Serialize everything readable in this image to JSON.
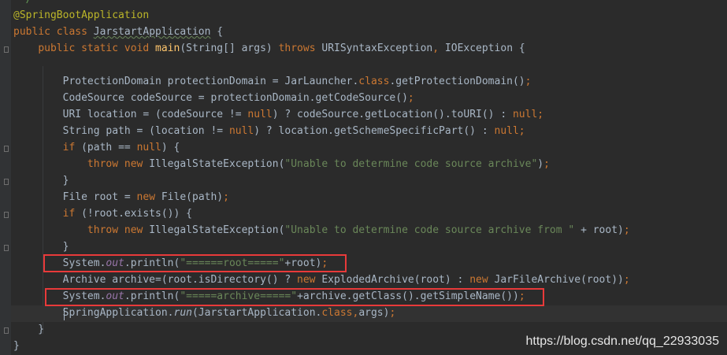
{
  "editor": {
    "comment_end": " */",
    "lines": [
      {
        "parts": [
          {
            "c": "ann",
            "t": "@SpringBootApplication"
          }
        ]
      },
      {
        "parts": [
          {
            "c": "kw",
            "t": "public class "
          },
          {
            "c": "squig",
            "t": "JarstartApplication"
          },
          {
            "c": "",
            "t": " {"
          }
        ]
      },
      {
        "parts": [
          {
            "c": "",
            "t": "    "
          },
          {
            "c": "kw",
            "t": "public static void "
          },
          {
            "c": "fn",
            "t": "main"
          },
          {
            "c": "",
            "t": "(String[] args) "
          },
          {
            "c": "kw",
            "t": "throws "
          },
          {
            "c": "",
            "t": "URISyntaxException"
          },
          {
            "c": "kw",
            "t": ", "
          },
          {
            "c": "",
            "t": "IOException {"
          }
        ]
      },
      {
        "parts": [
          {
            "c": "",
            "t": ""
          }
        ]
      },
      {
        "parts": [
          {
            "c": "",
            "t": "        ProtectionDomain protectionDomain = JarLauncher."
          },
          {
            "c": "kw",
            "t": "class"
          },
          {
            "c": "",
            "t": ".getProtectionDomain()"
          },
          {
            "c": "kw",
            "t": ";"
          }
        ]
      },
      {
        "parts": [
          {
            "c": "",
            "t": "        CodeSource codeSource = protectionDomain.getCodeSource()"
          },
          {
            "c": "kw",
            "t": ";"
          }
        ]
      },
      {
        "parts": [
          {
            "c": "",
            "t": "        URI location = (codeSource != "
          },
          {
            "c": "kw",
            "t": "null"
          },
          {
            "c": "",
            "t": ") ? codeSource.getLocation().toURI() : "
          },
          {
            "c": "kw",
            "t": "null;"
          }
        ]
      },
      {
        "parts": [
          {
            "c": "",
            "t": "        String path = (location != "
          },
          {
            "c": "kw",
            "t": "null"
          },
          {
            "c": "",
            "t": ") ? location.getSchemeSpecificPart() : "
          },
          {
            "c": "kw",
            "t": "null;"
          }
        ]
      },
      {
        "parts": [
          {
            "c": "",
            "t": "        "
          },
          {
            "c": "kw",
            "t": "if "
          },
          {
            "c": "",
            "t": "(path == "
          },
          {
            "c": "kw",
            "t": "null"
          },
          {
            "c": "",
            "t": ") {"
          }
        ]
      },
      {
        "parts": [
          {
            "c": "",
            "t": "            "
          },
          {
            "c": "kw",
            "t": "throw new "
          },
          {
            "c": "",
            "t": "IllegalStateException("
          },
          {
            "c": "str",
            "t": "\"Unable to determine code source archive\""
          },
          {
            "c": "",
            "t": ")"
          },
          {
            "c": "kw",
            "t": ";"
          }
        ]
      },
      {
        "parts": [
          {
            "c": "",
            "t": "        }"
          }
        ]
      },
      {
        "parts": [
          {
            "c": "",
            "t": "        File root = "
          },
          {
            "c": "kw",
            "t": "new "
          },
          {
            "c": "",
            "t": "File(path)"
          },
          {
            "c": "kw",
            "t": ";"
          }
        ]
      },
      {
        "parts": [
          {
            "c": "",
            "t": "        "
          },
          {
            "c": "kw",
            "t": "if "
          },
          {
            "c": "",
            "t": "(!root.exists()) {"
          }
        ]
      },
      {
        "parts": [
          {
            "c": "",
            "t": "            "
          },
          {
            "c": "kw",
            "t": "throw new "
          },
          {
            "c": "",
            "t": "IllegalStateException("
          },
          {
            "c": "str",
            "t": "\"Unable to determine code source archive from \""
          },
          {
            "c": "",
            "t": " + root)"
          },
          {
            "c": "kw",
            "t": ";"
          }
        ]
      },
      {
        "parts": [
          {
            "c": "",
            "t": "        }"
          }
        ]
      },
      {
        "parts": [
          {
            "c": "",
            "t": "        System."
          },
          {
            "c": "fld",
            "t": "out"
          },
          {
            "c": "",
            "t": ".println("
          },
          {
            "c": "str",
            "t": "\"======root=====\""
          },
          {
            "c": "",
            "t": "+root)"
          },
          {
            "c": "kw",
            "t": ";"
          }
        ]
      },
      {
        "parts": [
          {
            "c": "",
            "t": "        Archive archive=(root.isDirectory() ? "
          },
          {
            "c": "kw",
            "t": "new "
          },
          {
            "c": "",
            "t": "ExplodedArchive(root) : "
          },
          {
            "c": "kw",
            "t": "new "
          },
          {
            "c": "",
            "t": "JarFileArchive(root))"
          },
          {
            "c": "kw",
            "t": ";"
          }
        ]
      },
      {
        "parts": [
          {
            "c": "",
            "t": "        System."
          },
          {
            "c": "fld",
            "t": "out"
          },
          {
            "c": "",
            "t": ".println("
          },
          {
            "c": "str",
            "t": "\"=====archive=====\""
          },
          {
            "c": "",
            "t": "+archive.getClass().getSimpleName())"
          },
          {
            "c": "kw",
            "t": ";"
          }
        ]
      },
      {
        "parts": [
          {
            "c": "",
            "t": "        SpringApplication."
          },
          {
            "c": "st",
            "t": "run"
          },
          {
            "c": "",
            "t": "(JarstartApplication."
          },
          {
            "c": "kw",
            "t": "class"
          },
          {
            "c": "kw",
            "t": ","
          },
          {
            "c": "",
            "t": "args)"
          },
          {
            "c": "kw",
            "t": ";"
          }
        ]
      },
      {
        "parts": [
          {
            "c": "",
            "t": "    }"
          }
        ]
      },
      {
        "parts": [
          {
            "c": "",
            "t": "}"
          }
        ]
      }
    ]
  },
  "watermark": "https://blog.csdn.net/qq_22933035",
  "colors": {
    "background": "#2b2b2b",
    "keyword": "#cc7832",
    "string": "#6a8759",
    "annotation": "#bbb529",
    "method": "#ffc66d",
    "field": "#9876aa",
    "highlight_box": "#e83a3a"
  }
}
